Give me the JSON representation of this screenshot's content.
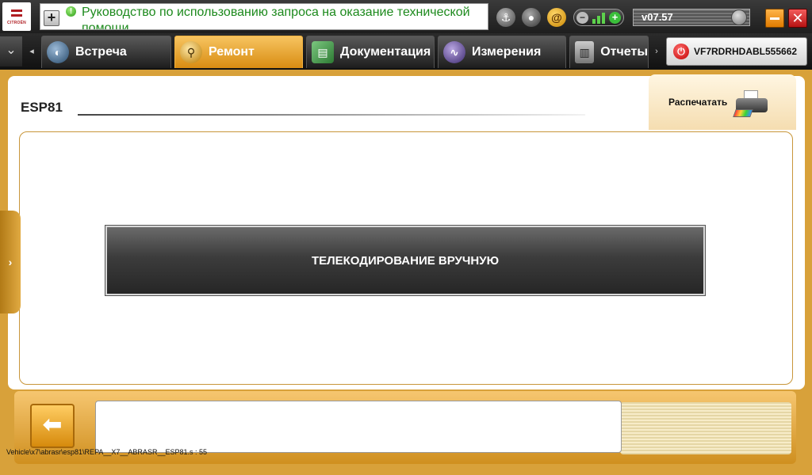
{
  "brand": {
    "logo_text": "CITROËN"
  },
  "notification": {
    "plus_label": "+",
    "info_glyph": "!",
    "text": "Руководство по использованию запроса на оказание технической помощи"
  },
  "toolbar": {
    "anchor_icon": "anchor-icon",
    "user_icon": "user-icon",
    "at_icon": "at-icon",
    "signal_minus": "−",
    "signal_plus": "+",
    "version": "v07.57",
    "minimize_icon": "minimize-icon",
    "close_glyph": "✕"
  },
  "tabs": [
    {
      "label": "Встреча",
      "icon": "meeting-icon",
      "active": false
    },
    {
      "label": "Ремонт",
      "icon": "magnifier-icon",
      "active": true
    },
    {
      "label": "Документация",
      "icon": "book-icon",
      "active": false
    },
    {
      "label": "Измерения",
      "icon": "waveform-icon",
      "active": false
    },
    {
      "label": "Отчеты",
      "icon": "report-icon",
      "active": false
    }
  ],
  "tab_nav": {
    "menu_glyph": "❯",
    "left_glyph": "◂",
    "right_glyph": "›"
  },
  "vin": {
    "power_glyph": "⏻",
    "value": "VF7RDRHDABL555662"
  },
  "page": {
    "title": "ESP81",
    "print_label": "Распечатать",
    "action_label": "ТЕЛЕКОДИРОВАНИЕ ВРУЧНУЮ",
    "side_handle_glyph": "›",
    "back_glyph": "⬅",
    "path": "Vehicle\\x7\\abrasr\\esp81\\REPA__X7__ABRASR__ESP81.s : 55"
  },
  "colors": {
    "accent": "#d88c12",
    "frame": "#d8a13a",
    "notification_text": "#1d8a1d"
  }
}
